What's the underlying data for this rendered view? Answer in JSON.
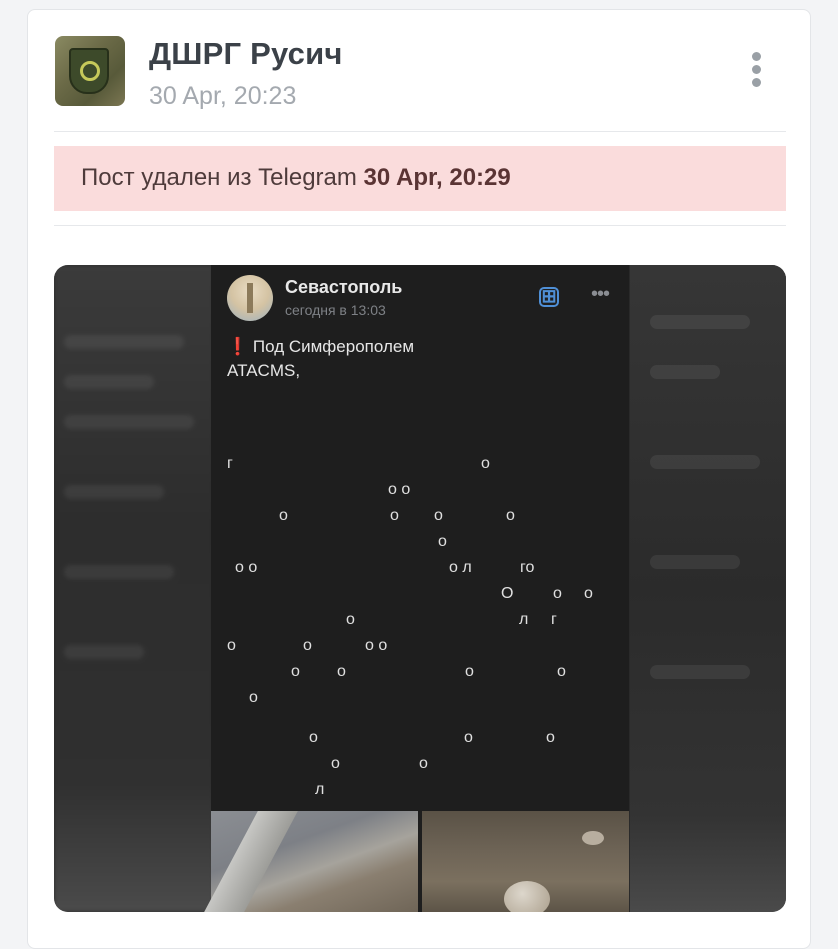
{
  "post": {
    "author": "ДШРГ Русич",
    "timestamp": "30 Apr, 20:23",
    "menu_icon": "more-vertical-icon"
  },
  "deleted_notice": {
    "text": "Пост удален из Telegram",
    "time": "30 Apr, 20:29"
  },
  "embedded_post": {
    "name": "Севастополь",
    "time": "сегодня в 13:03",
    "line1": "Под Симферополем",
    "line2": "ATACMS,",
    "mark": "❗",
    "add_icon": "⊞",
    "more": "•••",
    "fragments": [
      "г",
      "о",
      "о о",
      "о",
      "о",
      "о",
      "о",
      "о",
      "о о",
      "о л",
      "го",
      "О",
      "о",
      "о",
      "о",
      "л",
      "г",
      "о",
      "о",
      "о о",
      "о",
      "о",
      "о",
      "о",
      "о",
      "о",
      "о",
      "о",
      "о",
      "о",
      "л"
    ]
  },
  "colors": {
    "banner_bg": "#fadcdc",
    "accent_blue": "#4f8fd6",
    "alert_red": "#e53935"
  }
}
